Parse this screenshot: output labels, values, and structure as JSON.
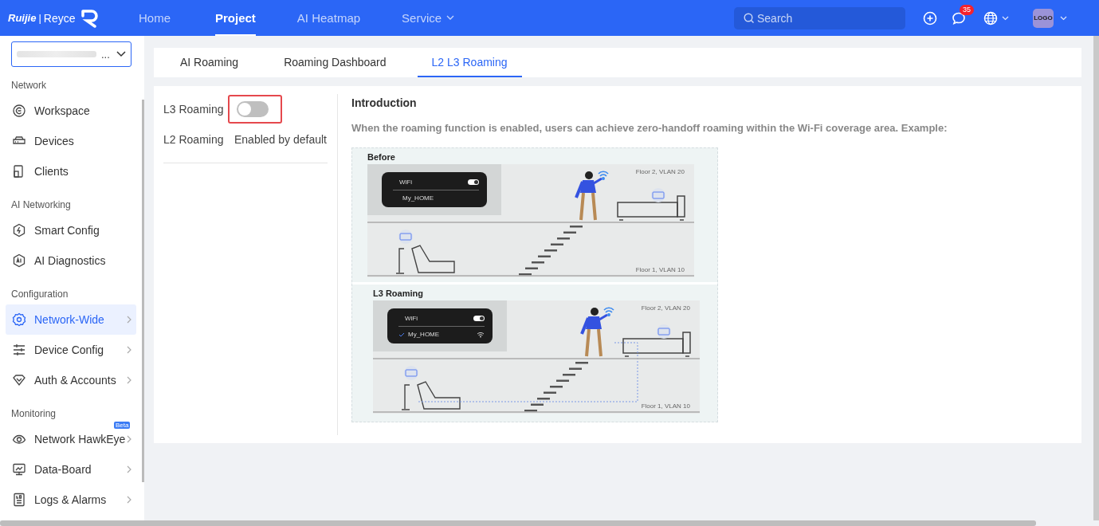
{
  "header": {
    "logo": {
      "brand": "Ruijie",
      "separator": "|",
      "sub": "Reyce"
    },
    "nav": [
      {
        "label": "Home",
        "selected": false,
        "dropdown": false
      },
      {
        "label": "Project",
        "selected": true,
        "dropdown": false
      },
      {
        "label": "AI Heatmap",
        "selected": false,
        "dropdown": false
      },
      {
        "label": "Service",
        "selected": false,
        "dropdown": true
      }
    ],
    "search": {
      "placeholder": "Search"
    },
    "notifications": {
      "badge": "35"
    },
    "avatar": "LOGO"
  },
  "sidebar": {
    "project_select": {
      "value": "..."
    },
    "sections": [
      {
        "title": "Network",
        "items": [
          {
            "label": "Workspace",
            "selected": false,
            "expandable": false
          },
          {
            "label": "Devices",
            "selected": false,
            "expandable": false
          },
          {
            "label": "Clients",
            "selected": false,
            "expandable": false
          }
        ]
      },
      {
        "title": "AI Networking",
        "items": [
          {
            "label": "Smart Config",
            "selected": false,
            "expandable": false
          },
          {
            "label": "AI Diagnostics",
            "selected": false,
            "expandable": false
          }
        ]
      },
      {
        "title": "Configuration",
        "items": [
          {
            "label": "Network-Wide",
            "selected": true,
            "expandable": true
          },
          {
            "label": "Device Config",
            "selected": false,
            "expandable": true
          },
          {
            "label": "Auth & Accounts",
            "selected": false,
            "expandable": true
          }
        ]
      },
      {
        "title": "Monitoring",
        "items": [
          {
            "label": "Network HawkEye",
            "selected": false,
            "expandable": true,
            "badge": "Beta"
          },
          {
            "label": "Data-Board",
            "selected": false,
            "expandable": true
          },
          {
            "label": "Logs & Alarms",
            "selected": false,
            "expandable": true
          }
        ]
      }
    ]
  },
  "tabs": [
    {
      "label": "AI Roaming",
      "selected": false
    },
    {
      "label": "Roaming Dashboard",
      "selected": false
    },
    {
      "label": "L2 L3 Roaming",
      "selected": true
    }
  ],
  "settings": [
    {
      "kind": "switch",
      "label": "L3 Roaming",
      "on": false,
      "highlighted": true
    },
    {
      "kind": "text",
      "label": "L2 Roaming",
      "value": "Enabled by default"
    }
  ],
  "introduction": {
    "title": "Introduction",
    "text": "When the roaming function is enabled, users can achieve zero-handoff roaming within the Wi-Fi coverage area. Example:",
    "panels": [
      {
        "title": "Before",
        "wifi_label": "WiFi",
        "wifi_on": true,
        "network": "My_HOME",
        "connected": false,
        "upper_floor": "Floor 2, VLAN 20",
        "lower_floor": "Floor 1, VLAN 10"
      },
      {
        "title": "L3 Roaming",
        "wifi_label": "WiFi",
        "wifi_on": true,
        "network": "My_HOME",
        "connected": true,
        "upper_floor": "Floor 2, VLAN 20",
        "lower_floor": "Floor 1, VLAN 10"
      }
    ]
  }
}
